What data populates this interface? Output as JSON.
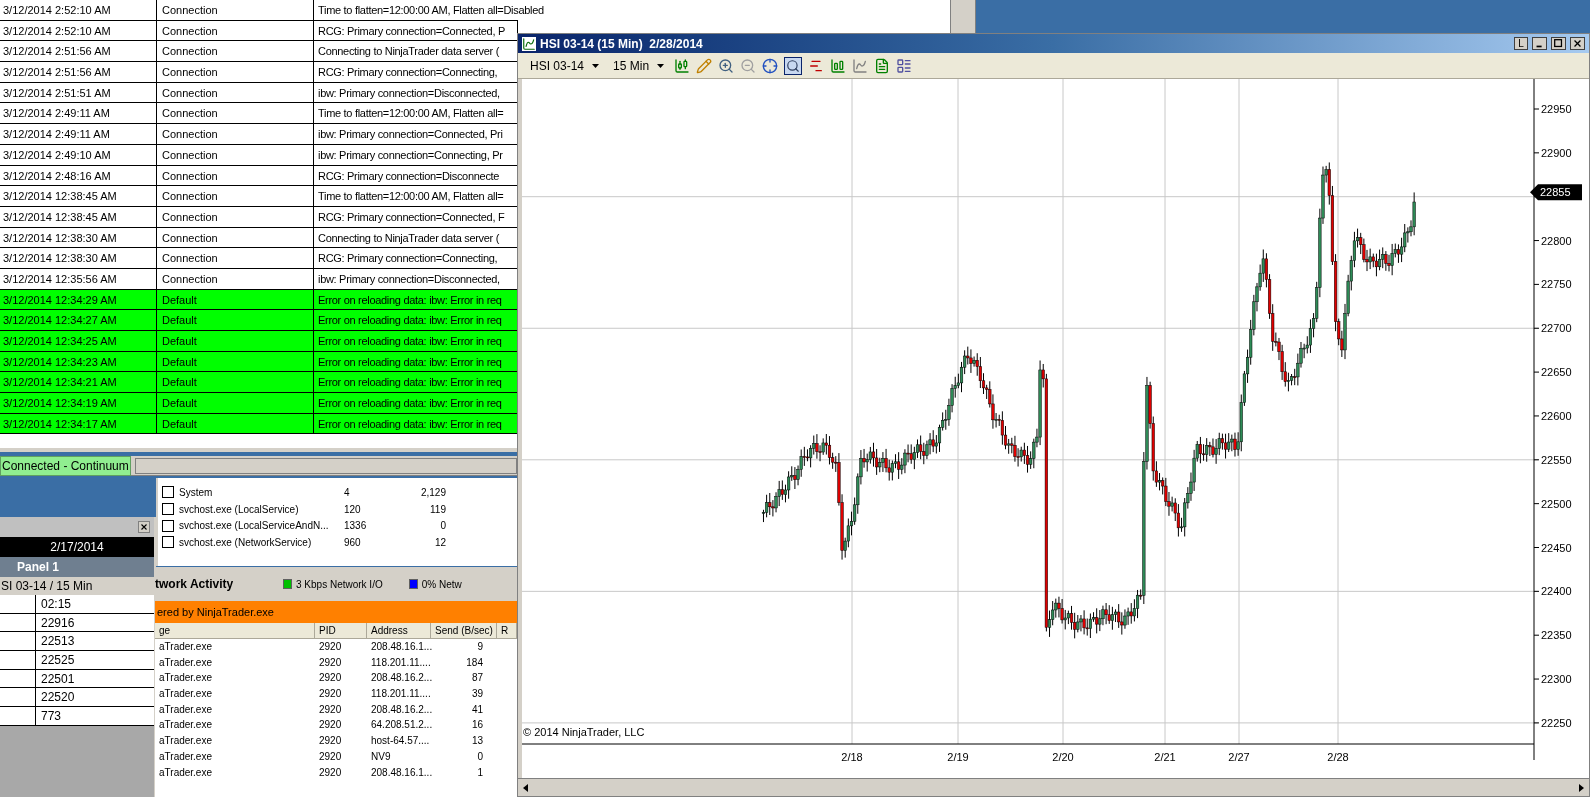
{
  "log_table": {
    "rows": [
      {
        "time": "3/12/2014 2:52:10 AM",
        "category": "Connection",
        "message": "Time to flatten=12:00:00 AM, Flatten all=Disabled",
        "highlighted": false
      },
      {
        "time": "3/12/2014 2:52:10 AM",
        "category": "Connection",
        "message": "RCG: Primary connection=Connected, P",
        "highlighted": false
      },
      {
        "time": "3/12/2014 2:51:56 AM",
        "category": "Connection",
        "message": "Connecting to NinjaTrader data server (",
        "highlighted": false
      },
      {
        "time": "3/12/2014 2:51:56 AM",
        "category": "Connection",
        "message": "RCG: Primary connection=Connecting,",
        "highlighted": false
      },
      {
        "time": "3/12/2014 2:51:51 AM",
        "category": "Connection",
        "message": "ibw: Primary connection=Disconnected,",
        "highlighted": false
      },
      {
        "time": "3/12/2014 2:49:11 AM",
        "category": "Connection",
        "message": "Time to flatten=12:00:00 AM, Flatten all=",
        "highlighted": false
      },
      {
        "time": "3/12/2014 2:49:11 AM",
        "category": "Connection",
        "message": "ibw: Primary connection=Connected, Pri",
        "highlighted": false
      },
      {
        "time": "3/12/2014 2:49:10 AM",
        "category": "Connection",
        "message": "ibw: Primary connection=Connecting, Pr",
        "highlighted": false
      },
      {
        "time": "3/12/2014 2:48:16 AM",
        "category": "Connection",
        "message": "RCG: Primary connection=Disconnecte",
        "highlighted": false
      },
      {
        "time": "3/12/2014 12:38:45 AM",
        "category": "Connection",
        "message": "Time to flatten=12:00:00 AM, Flatten all=",
        "highlighted": false
      },
      {
        "time": "3/12/2014 12:38:45 AM",
        "category": "Connection",
        "message": "RCG: Primary connection=Connected, F",
        "highlighted": false
      },
      {
        "time": "3/12/2014 12:38:30 AM",
        "category": "Connection",
        "message": "Connecting to NinjaTrader data server (",
        "highlighted": false
      },
      {
        "time": "3/12/2014 12:38:30 AM",
        "category": "Connection",
        "message": "RCG: Primary connection=Connecting,",
        "highlighted": false
      },
      {
        "time": "3/12/2014 12:35:56 AM",
        "category": "Connection",
        "message": "ibw: Primary connection=Disconnected,",
        "highlighted": false
      },
      {
        "time": "3/12/2014 12:34:29 AM",
        "category": "Default",
        "message": "Error on reloading data: ibw: Error in req",
        "highlighted": true
      },
      {
        "time": "3/12/2014 12:34:27 AM",
        "category": "Default",
        "message": "Error on reloading data: ibw: Error in req",
        "highlighted": true
      },
      {
        "time": "3/12/2014 12:34:25 AM",
        "category": "Default",
        "message": "Error on reloading data: ibw: Error in req",
        "highlighted": true
      },
      {
        "time": "3/12/2014 12:34:23 AM",
        "category": "Default",
        "message": "Error on reloading data: ibw: Error in req",
        "highlighted": true
      },
      {
        "time": "3/12/2014 12:34:21 AM",
        "category": "Default",
        "message": "Error on reloading data: ibw: Error in req",
        "highlighted": true
      },
      {
        "time": "3/12/2014 12:34:19 AM",
        "category": "Default",
        "message": "Error on reloading data: ibw: Error in req",
        "highlighted": true
      },
      {
        "time": "3/12/2014 12:34:17 AM",
        "category": "Default",
        "message": "Error on reloading data: ibw: Error in req",
        "highlighted": true
      }
    ]
  },
  "status_bar": {
    "connection": "Connected - Continuum"
  },
  "market_panel": {
    "date": "2/17/2014",
    "title": "Panel 1",
    "instrument": "SI 03-14 / 15 Min",
    "values": [
      "02:15",
      "22916",
      "22513",
      "22525",
      "22501",
      "22520",
      "773"
    ]
  },
  "process_list": {
    "rows": [
      {
        "name": "System",
        "pid": "4",
        "value": "2,129",
        "checked": false
      },
      {
        "name": "svchost.exe (LocalService)",
        "pid": "120",
        "value": "119",
        "checked": false
      },
      {
        "name": "svchost.exe (LocalServiceAndN...",
        "pid": "1336",
        "value": "0",
        "checked": false
      },
      {
        "name": "svchost.exe (NetworkService)",
        "pid": "960",
        "value": "12",
        "checked": false
      }
    ]
  },
  "network_activity": {
    "title": "twork Activity",
    "legend": [
      {
        "label": "3 Kbps Network I/O",
        "color": "#00c000"
      },
      {
        "label": "0% Netw",
        "color": "#0000ff"
      }
    ],
    "filter": "ered by NinjaTrader.exe",
    "columns": [
      "ge",
      "PID",
      "Address",
      "Send (B/sec)",
      "R"
    ],
    "rows": [
      [
        "aTrader.exe",
        "2920",
        "208.48.16.1...",
        "9"
      ],
      [
        "aTrader.exe",
        "2920",
        "118.201.11....",
        "184"
      ],
      [
        "aTrader.exe",
        "2920",
        "208.48.16.2...",
        "87"
      ],
      [
        "aTrader.exe",
        "2920",
        "118.201.11....",
        "39"
      ],
      [
        "aTrader.exe",
        "2920",
        "208.48.16.2...",
        "41"
      ],
      [
        "aTrader.exe",
        "2920",
        "64.208.51.2...",
        "16"
      ],
      [
        "aTrader.exe",
        "2920",
        "host-64.57....",
        "13"
      ],
      [
        "aTrader.exe",
        "2920",
        "NV9",
        "0"
      ],
      [
        "aTrader.exe",
        "2920",
        "208.48.16.1...",
        "1"
      ]
    ]
  },
  "chart_window": {
    "title": "HSI 03-14 (15 Min)  2/28/2014",
    "layout_button": "L",
    "instrument": "HSI 03-14",
    "interval": "15 Min",
    "price_marker": "22855",
    "y_axis_labels": [
      "22950",
      "22900",
      "22800",
      "22750",
      "22700",
      "22650",
      "22600",
      "22550",
      "22500",
      "22450",
      "22400",
      "22350",
      "22300",
      "22250"
    ],
    "x_axis_labels": [
      "2/18",
      "2/19",
      "2/20",
      "2/21",
      "2/27",
      "2/28"
    ],
    "copyright": "© 2014 NinjaTrader, LLC"
  }
}
